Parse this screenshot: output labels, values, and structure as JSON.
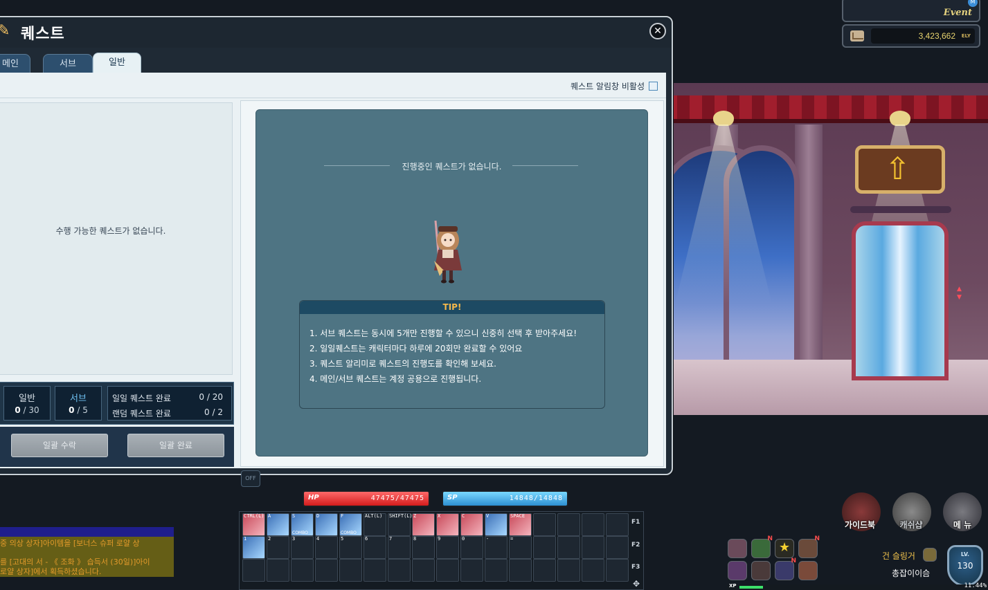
{
  "quest_window": {
    "title": "퀘스트",
    "close_glyph": "✕",
    "tabs": [
      {
        "label": "메인",
        "active": false
      },
      {
        "label": "서브",
        "active": false
      },
      {
        "label": "일반",
        "active": true
      }
    ],
    "notify_toggle_label": "퀘스트 알림창 비활성",
    "notify_toggle_checked": false,
    "available_empty_text": "수행 가능한 퀘스트가 없습니다.",
    "in_progress_empty_text": "진행중인 퀘스트가 없습니다.",
    "stats": {
      "general": {
        "label": "일반",
        "current": "0",
        "max": "/ 30"
      },
      "sub": {
        "label": "서브",
        "current": "0",
        "max": "/ 5"
      },
      "daily": {
        "label": "일일 퀘스트 완료",
        "value": "0 / 20"
      },
      "random": {
        "label": "랜덤 퀘스트 완료",
        "value": "0 / 2"
      }
    },
    "buttons": {
      "accept_all": "일괄 수락",
      "complete_all": "일괄 완료"
    },
    "tip": {
      "title": "TIP!",
      "lines": [
        "1. 서브 퀘스트는 동시에 5개만 진행할 수 있으니 신중히 선택 후 받아주세요!",
        "2. 일일퀘스트는 캐릭터마다 하루에 20회만 완료할 수 있어요",
        "3. 퀘스트 알리미로 퀘스트의 진행도를 확인해 보세요.",
        "4. 메인/서브 퀘스트는 계정 공용으로 진행됩니다."
      ]
    }
  },
  "top_right": {
    "event_label": "Event",
    "event_badge": "M",
    "meso_value": "3,423,662",
    "meso_unit": "ELY"
  },
  "hud": {
    "hp": {
      "label": "HP",
      "value": "47475/47475",
      "fraction": 1.0
    },
    "sp": {
      "label": "SP",
      "value": "14848/14848",
      "fraction": 1.0
    },
    "off_label": "OFF",
    "xp": {
      "label": "XP",
      "value": "11.44%",
      "fraction": 0.1144
    },
    "level_label": "LV.",
    "level": "130",
    "character_name": "건 슬링거",
    "character_job": "총잡이이슴",
    "menu": [
      {
        "label": "가이드북",
        "icon": "guidebook-icon"
      },
      {
        "label": "캐쉬샵",
        "icon": "cash-shop-icon"
      },
      {
        "label": "메 뉴",
        "icon": "menu-icon"
      }
    ],
    "function_keys": [
      "F1",
      "F2",
      "F3"
    ],
    "skill_keys_row1": [
      "CTRL(L)",
      "A",
      "S",
      "D",
      "F",
      "ALT(L)",
      "SHIFT(L)",
      "Z",
      "X",
      "C",
      "V",
      "SPACE"
    ],
    "skill_keys_row2": [
      "1",
      "2",
      "3",
      "4",
      "5",
      "6",
      "7",
      "8",
      "9",
      "0",
      "-",
      "="
    ],
    "combo_label": "COMBO"
  },
  "chat": {
    "lines": [
      "중 의상 상자]아이템을 [보너스 슈퍼 로얄 상",
      "를 [고대의 서 - 《 조화 》 습득서 (30일)]아이",
      "로얄 상자]에서 획득하셨습니다."
    ]
  },
  "colors": {
    "hp": "#d31c1c",
    "sp": "#2d8fd1",
    "tip_title": "#f5b84b",
    "panel": "#4e7483"
  }
}
